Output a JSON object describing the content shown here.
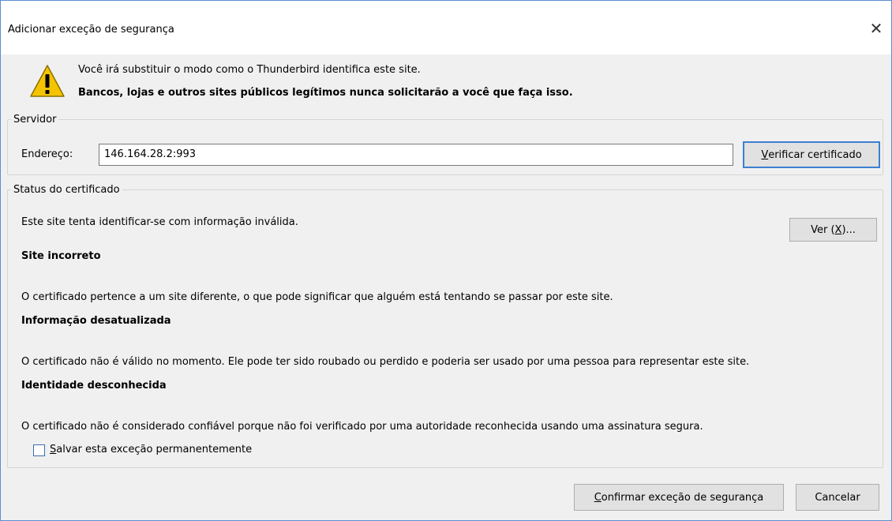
{
  "window": {
    "title": "Adicionar exceção de segurança",
    "close_glyph": "✕"
  },
  "warning": {
    "icon": "warning-triangle-icon",
    "line1": "Você irá substituir o modo como o Thunderbird identifica este site.",
    "line2": "Bancos, lojas e outros sites públicos legítimos nunca solicitarão a você que faça isso."
  },
  "server": {
    "group_label": "Servidor",
    "address_label": "Endereço:",
    "address_value": "146.164.28.2:993",
    "verify_button_mnemonic": "V",
    "verify_button_rest": "erificar certificado"
  },
  "cert_status": {
    "group_label": "Status do certificado",
    "summary": "Este site tenta identificar-se com informação inválida.",
    "view_button_prefix": "Ver (",
    "view_button_mnemonic": "X",
    "view_button_suffix": ")...",
    "issues": [
      {
        "heading": "Site incorreto",
        "description": "O certificado pertence a um site diferente, o que pode significar que alguém está tentando se passar por este site."
      },
      {
        "heading": "Informação desatualizada",
        "description": "O certificado não é válido no momento. Ele pode ter sido roubado ou perdido e poderia ser usado por uma pessoa para representar este site."
      },
      {
        "heading": "Identidade desconhecida",
        "description": "O certificado não é considerado confiável porque não foi verificado por uma autoridade reconhecida usando uma assinatura segura."
      }
    ],
    "save_checkbox_mnemonic": "S",
    "save_checkbox_rest": "alvar esta exceção permanentemente",
    "save_checked": false
  },
  "footer": {
    "confirm_mnemonic": "C",
    "confirm_rest": "onfirmar exceção de segurança",
    "cancel_label": "Cancelar"
  },
  "colors": {
    "accent": "#3c7fd1",
    "warning_yellow": "#f5c400"
  }
}
